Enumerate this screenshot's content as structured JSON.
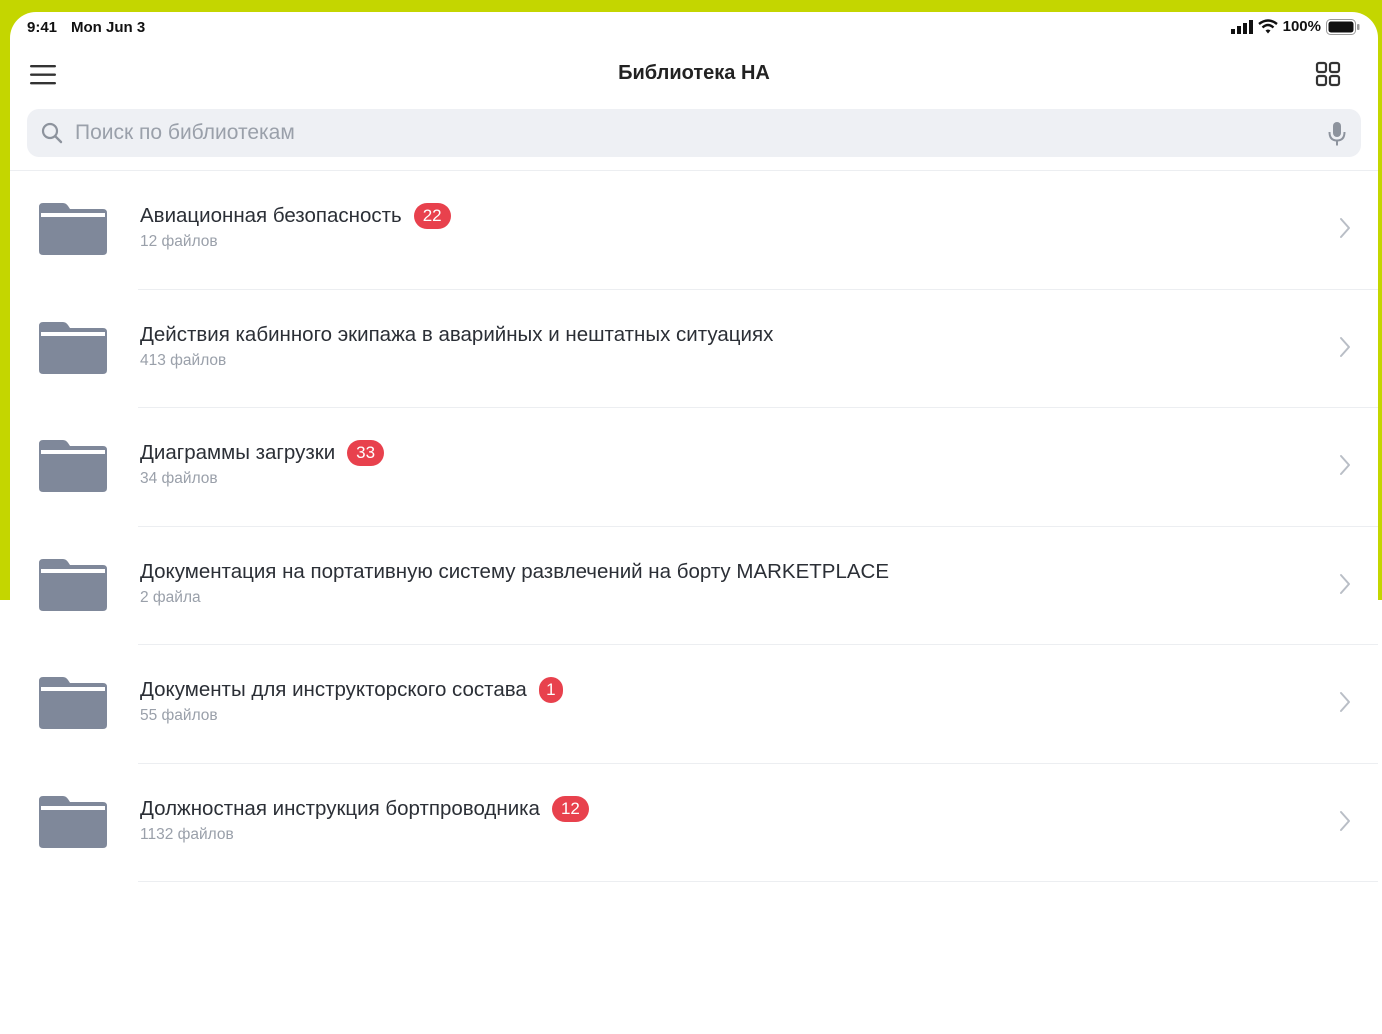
{
  "status_bar": {
    "time": "9:41",
    "date": "Mon Jun 3",
    "battery": "100%"
  },
  "nav": {
    "title": "Библиотека НА"
  },
  "search": {
    "placeholder": "Поиск по библиотекам"
  },
  "colors": {
    "accent_background": "#c4d600",
    "badge": "#e8414d",
    "folder": "#7f889a"
  },
  "libraries": [
    {
      "title": "Авиационная безопасность",
      "subtitle": "12 файлов",
      "badge": "22"
    },
    {
      "title": "Действия кабинного экипажа в аварийных и нештатных ситуациях",
      "subtitle": "413 файлов",
      "badge": ""
    },
    {
      "title": "Диаграммы загрузки",
      "subtitle": "34 файлов",
      "badge": "33"
    },
    {
      "title": "Документация на портативную систему развлечений на борту MARKETPLACE",
      "subtitle": "2 файла",
      "badge": ""
    },
    {
      "title": "Документы для инструкторского состава",
      "subtitle": "55 файлов",
      "badge": "1"
    },
    {
      "title": "Должностная инструкция бортпроводника",
      "subtitle": "1132 файлов",
      "badge": "12"
    }
  ]
}
